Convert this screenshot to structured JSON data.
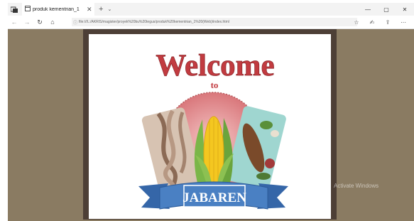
{
  "browser": {
    "tab": {
      "title": "produk kementrian_1"
    },
    "address": {
      "url": "file:///L:/AKRIS/magister/proyek%20bu%20tegus/produk%20kementrian_1%20(Web)/index.html"
    }
  },
  "welcome": {
    "title": "Welcome",
    "subtitle": "to",
    "banner": "JABAREN"
  },
  "system": {
    "watermark": "Activate Windows"
  },
  "colors": {
    "page_bg": "#8a7b62",
    "frame": "#4d3f36",
    "title": "#c33a3f",
    "banner": "#3f77bd",
    "circle": "#e79a9c"
  },
  "icons": [
    "tab-actions-icon",
    "tab-page-icon",
    "tab-close-icon",
    "new-tab-icon",
    "tab-menu-icon",
    "minimize-icon",
    "maximize-icon",
    "close-window-icon",
    "back-icon",
    "forward-icon",
    "refresh-icon",
    "home-icon",
    "info-icon",
    "favorite-icon",
    "reading-list-icon",
    "share-icon",
    "more-icon"
  ]
}
